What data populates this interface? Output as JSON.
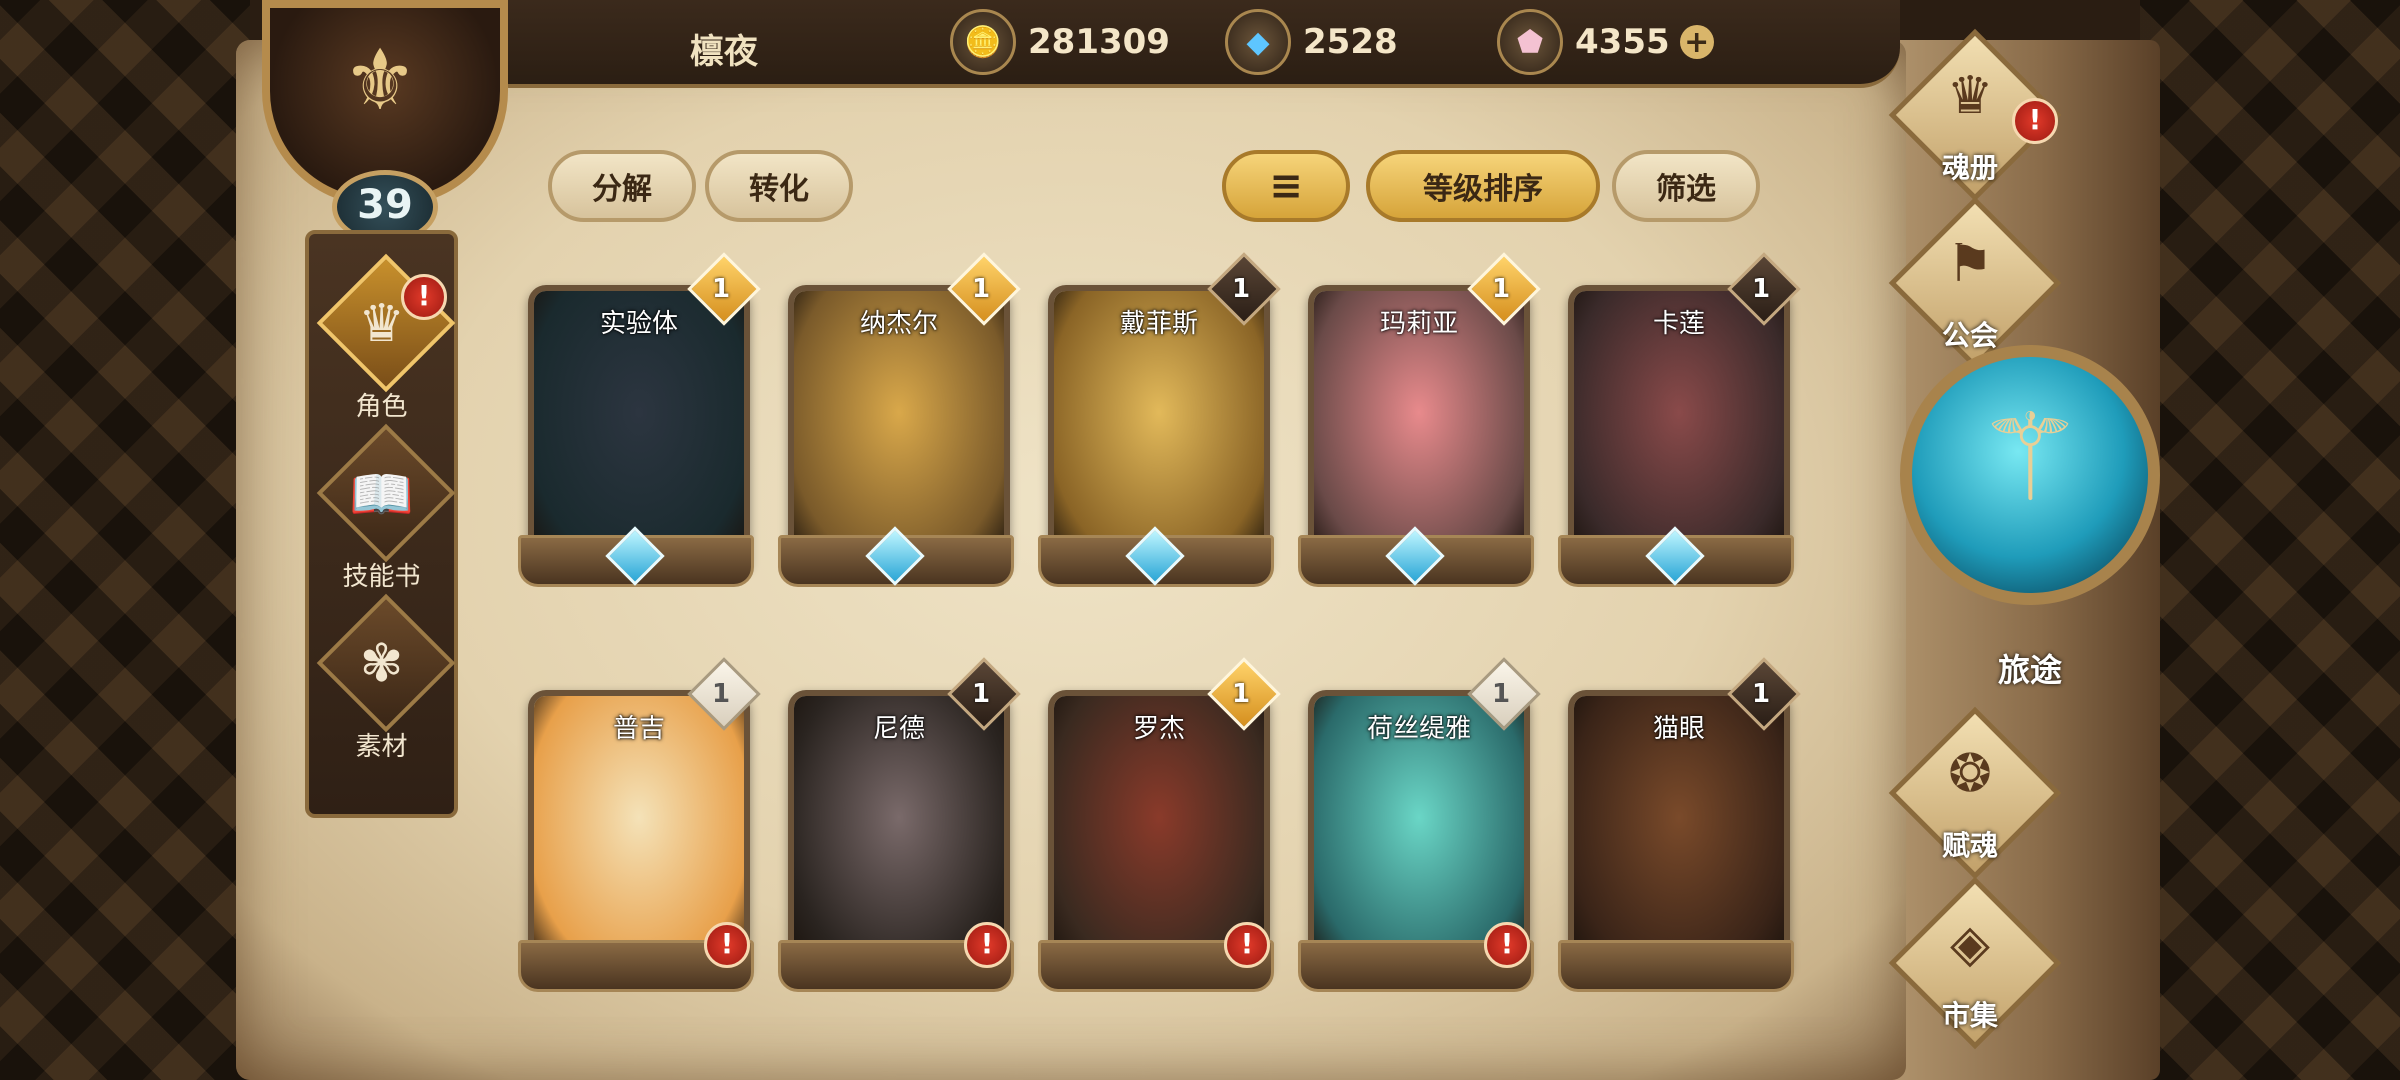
{
  "player": {
    "name": "檩夜",
    "level": "39"
  },
  "currencies": [
    {
      "icon": "gold-coin-icon",
      "value": "281309"
    },
    {
      "icon": "blue-crystal-icon",
      "value": "2528"
    },
    {
      "icon": "pink-gem-icon",
      "value": "4355"
    }
  ],
  "sidebar": {
    "items": [
      {
        "label": "角色",
        "icon": "character-icon",
        "active": true,
        "alert": "!"
      },
      {
        "label": "技能书",
        "icon": "skill-book-icon",
        "active": false
      },
      {
        "label": "素材",
        "icon": "material-icon",
        "active": false
      }
    ]
  },
  "toolbar": {
    "decompose": "分解",
    "convert": "转化",
    "sort_by_level": "等级排序",
    "filter": "筛选"
  },
  "heroes": [
    {
      "name": "实验体",
      "rank": "1",
      "rank_style": "gold",
      "colors": [
        "#2c3540",
        "#1a2a2e"
      ]
    },
    {
      "name": "纳杰尔",
      "rank": "1",
      "rank_style": "gold",
      "colors": [
        "#d9a84a",
        "#7a5a2a"
      ]
    },
    {
      "name": "戴菲斯",
      "rank": "1",
      "rank_style": "dark",
      "colors": [
        "#e2b95a",
        "#8a6426"
      ]
    },
    {
      "name": "玛莉亚",
      "rank": "1",
      "rank_style": "gold",
      "colors": [
        "#e88a8c",
        "#6a4a48"
      ]
    },
    {
      "name": "卡莲",
      "rank": "1",
      "rank_style": "dark",
      "colors": [
        "#8a4a4a",
        "#3a2a2a"
      ]
    },
    {
      "name": "普吉",
      "rank": "1",
      "rank_style": "light",
      "colors": [
        "#f4e2b8",
        "#e8a04a"
      ]
    },
    {
      "name": "尼德",
      "rank": "1",
      "rank_style": "dark",
      "colors": [
        "#7a6a6a",
        "#2a2420"
      ]
    },
    {
      "name": "罗杰",
      "rank": "1",
      "rank_style": "gold",
      "colors": [
        "#8a3a2a",
        "#3a2a20"
      ]
    },
    {
      "name": "荷丝缇雅",
      "rank": "1",
      "rank_style": "light",
      "colors": [
        "#6ad6c6",
        "#2a6a6a"
      ]
    },
    {
      "name": "猫眼",
      "rank": "1",
      "rank_style": "dark",
      "colors": [
        "#7a4a2a",
        "#3a2418"
      ]
    }
  ],
  "right_nav": [
    {
      "label": "魂册",
      "icon": "soul-book-icon",
      "alert": "!"
    },
    {
      "label": "公会",
      "icon": "guild-icon"
    },
    {
      "label": "旅途",
      "icon": "journey-icon"
    },
    {
      "label": "赋魂",
      "icon": "soul-infuse-icon"
    },
    {
      "label": "市集",
      "icon": "market-icon"
    }
  ]
}
